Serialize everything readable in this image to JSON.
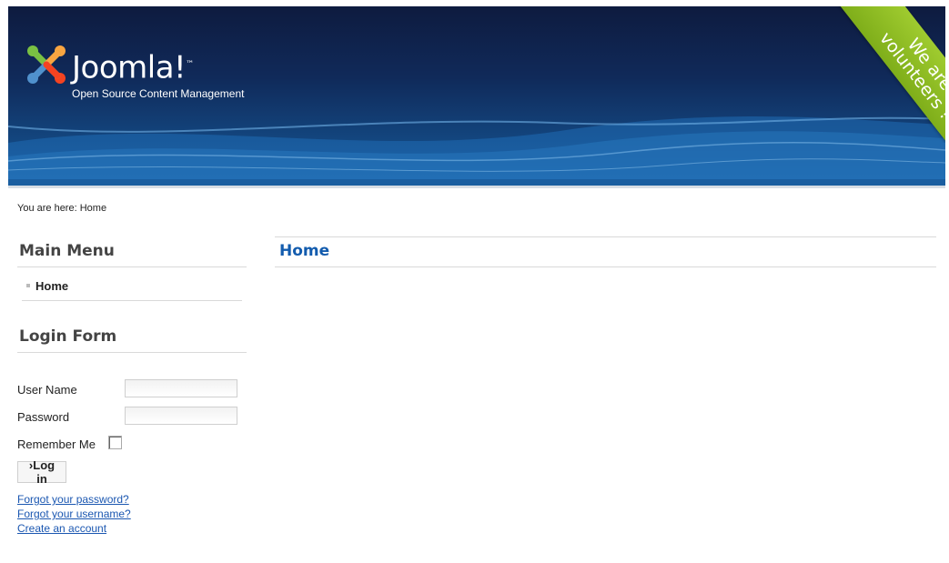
{
  "header": {
    "logo_text": "Joomla!",
    "logo_trademark": "™",
    "tagline": "Open Source Content Management",
    "ribbon_line1": "We are",
    "ribbon_line2": "volunteers !"
  },
  "breadcrumb": {
    "prefix": "You are here:",
    "current": "Home"
  },
  "main_menu": {
    "title": "Main Menu",
    "items": [
      {
        "label": "Home"
      }
    ]
  },
  "login_form": {
    "title": "Login Form",
    "username_label": "User Name",
    "username_value": "",
    "password_label": "Password",
    "password_value": "",
    "remember_label": "Remember Me",
    "remember_checked": false,
    "login_button": "›Log in",
    "links": [
      {
        "label": "Forgot your password?"
      },
      {
        "label": "Forgot your username?"
      },
      {
        "label": "Create an account"
      }
    ]
  },
  "main": {
    "title": "Home"
  },
  "colors": {
    "header_dark": "#0e1b3f",
    "header_light": "#1a5ea0",
    "ribbon": "#8fbf24",
    "link": "#1b57b1",
    "main_title": "#135cae"
  }
}
